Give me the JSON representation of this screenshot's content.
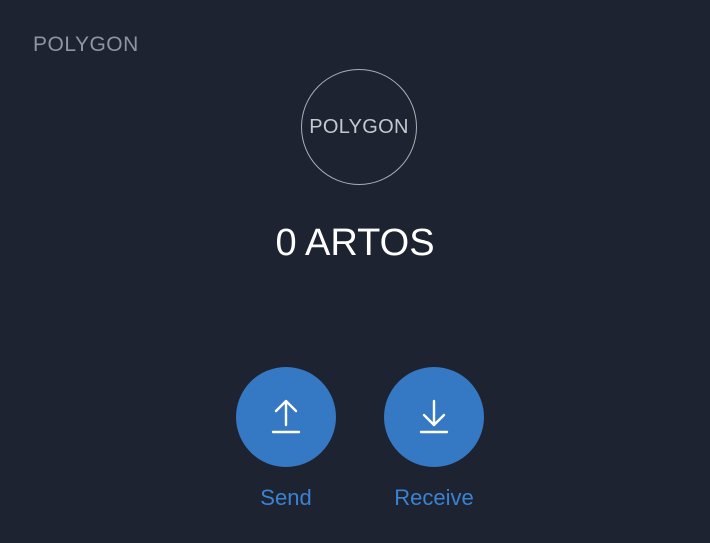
{
  "network": {
    "label": "POLYGON"
  },
  "token": {
    "logo_text": "POLYGON"
  },
  "balance": {
    "text": "0 ARTOS"
  },
  "actions": {
    "send": {
      "label": "Send",
      "icon": "upload-arrow-icon"
    },
    "receive": {
      "label": "Receive",
      "icon": "download-arrow-icon"
    }
  },
  "colors": {
    "background": "#1d2330",
    "accent": "#3578c3",
    "accent_text": "#3b82d3",
    "muted_text": "#8c95a4"
  }
}
